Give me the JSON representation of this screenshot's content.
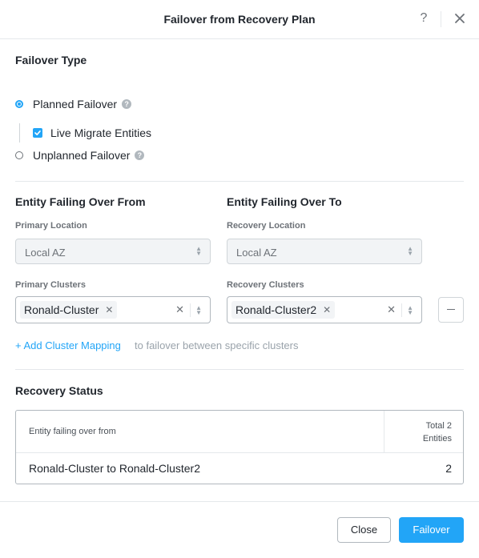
{
  "dialog": {
    "title": "Failover from Recovery Plan",
    "help_label": "?",
    "close_icon": "close-icon"
  },
  "failover_type": {
    "title": "Failover Type",
    "options": [
      {
        "label": "Planned Failover",
        "selected": true,
        "help_icon": "help-icon"
      },
      {
        "label": "Unplanned Failover",
        "selected": false,
        "help_icon": "help-icon"
      }
    ],
    "live_migrate": {
      "label": "Live Migrate Entities",
      "checked": true
    }
  },
  "from": {
    "title": "Entity Failing Over From",
    "location_label": "Primary Location",
    "location_value": "Local AZ",
    "clusters_label": "Primary Clusters",
    "cluster_tag": "Ronald-Cluster"
  },
  "to": {
    "title": "Entity Failing Over To",
    "location_label": "Recovery Location",
    "location_value": "Local AZ",
    "clusters_label": "Recovery Clusters",
    "cluster_tag": "Ronald-Cluster2"
  },
  "mapping": {
    "add_link": "+ Add Cluster Mapping",
    "hint": "to failover between specific clusters"
  },
  "recovery_status": {
    "title": "Recovery Status",
    "table": {
      "col_left": "Entity failing over from",
      "col_right_line1": "Total 2",
      "col_right_line2": "Entities",
      "rows": [
        {
          "name": "Ronald-Cluster to Ronald-Cluster2",
          "count": "2"
        }
      ]
    }
  },
  "footer": {
    "close_label": "Close",
    "failover_label": "Failover"
  },
  "colors": {
    "accent": "#22a5f7",
    "text": "#22272e",
    "muted": "#6d7278"
  }
}
